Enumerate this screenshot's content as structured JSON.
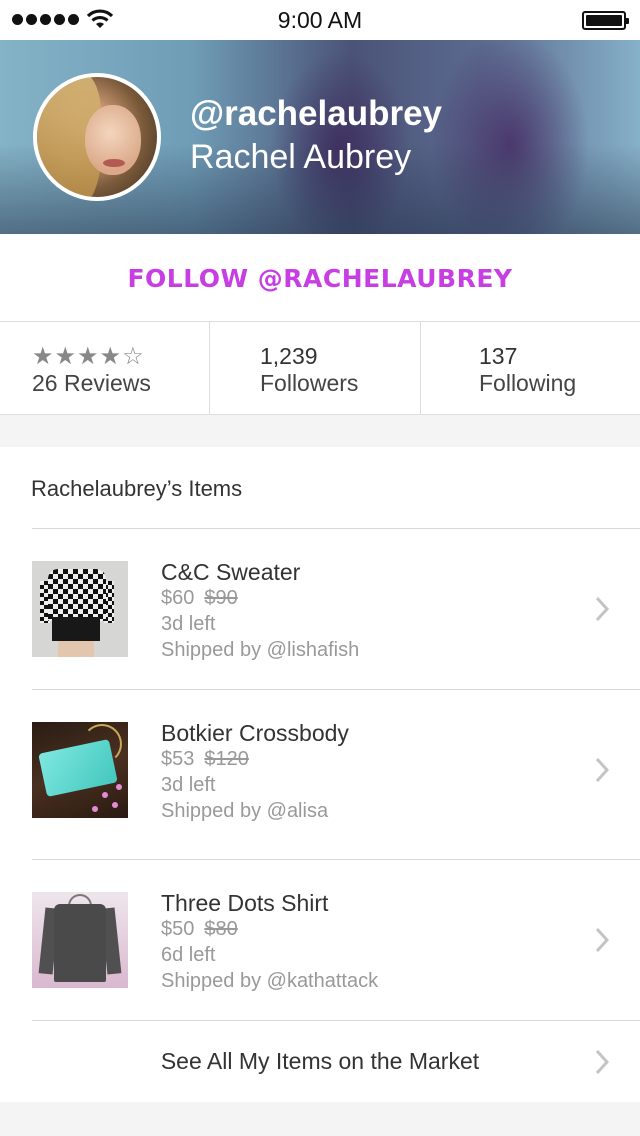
{
  "status_bar": {
    "time": "9:00 AM",
    "signal_icon": "signal-dots-icon",
    "wifi_icon": "wifi-icon",
    "battery_icon": "battery-icon"
  },
  "profile": {
    "username": "@rachelaubrey",
    "full_name": "Rachel Aubrey",
    "follow_label": "FOLLOW @RACHELAUBREY",
    "accent_color": "#c73fe3"
  },
  "stats": {
    "rating_stars": "★★★★☆",
    "rating_value": 4,
    "rating_max": 5,
    "reviews_label": "26 Reviews",
    "followers_count": "1,239",
    "followers_label": "Followers",
    "following_count": "137",
    "following_label": "Following"
  },
  "items_section": {
    "title": "Rachelaubrey’s Items",
    "items": [
      {
        "name": "C&C Sweater",
        "price": "$60",
        "original_price": "$90",
        "time_left": "3d left",
        "shipped_by": "Shipped by @lishafish"
      },
      {
        "name": "Botkier Crossbody",
        "price": "$53",
        "original_price": "$120",
        "time_left": "3d left",
        "shipped_by": "Shipped by @alisa"
      },
      {
        "name": "Three Dots Shirt",
        "price": "$50",
        "original_price": "$80",
        "time_left": "6d left",
        "shipped_by": "Shipped by @kathattack"
      }
    ],
    "see_all_label": "See All My Items on the Market"
  }
}
